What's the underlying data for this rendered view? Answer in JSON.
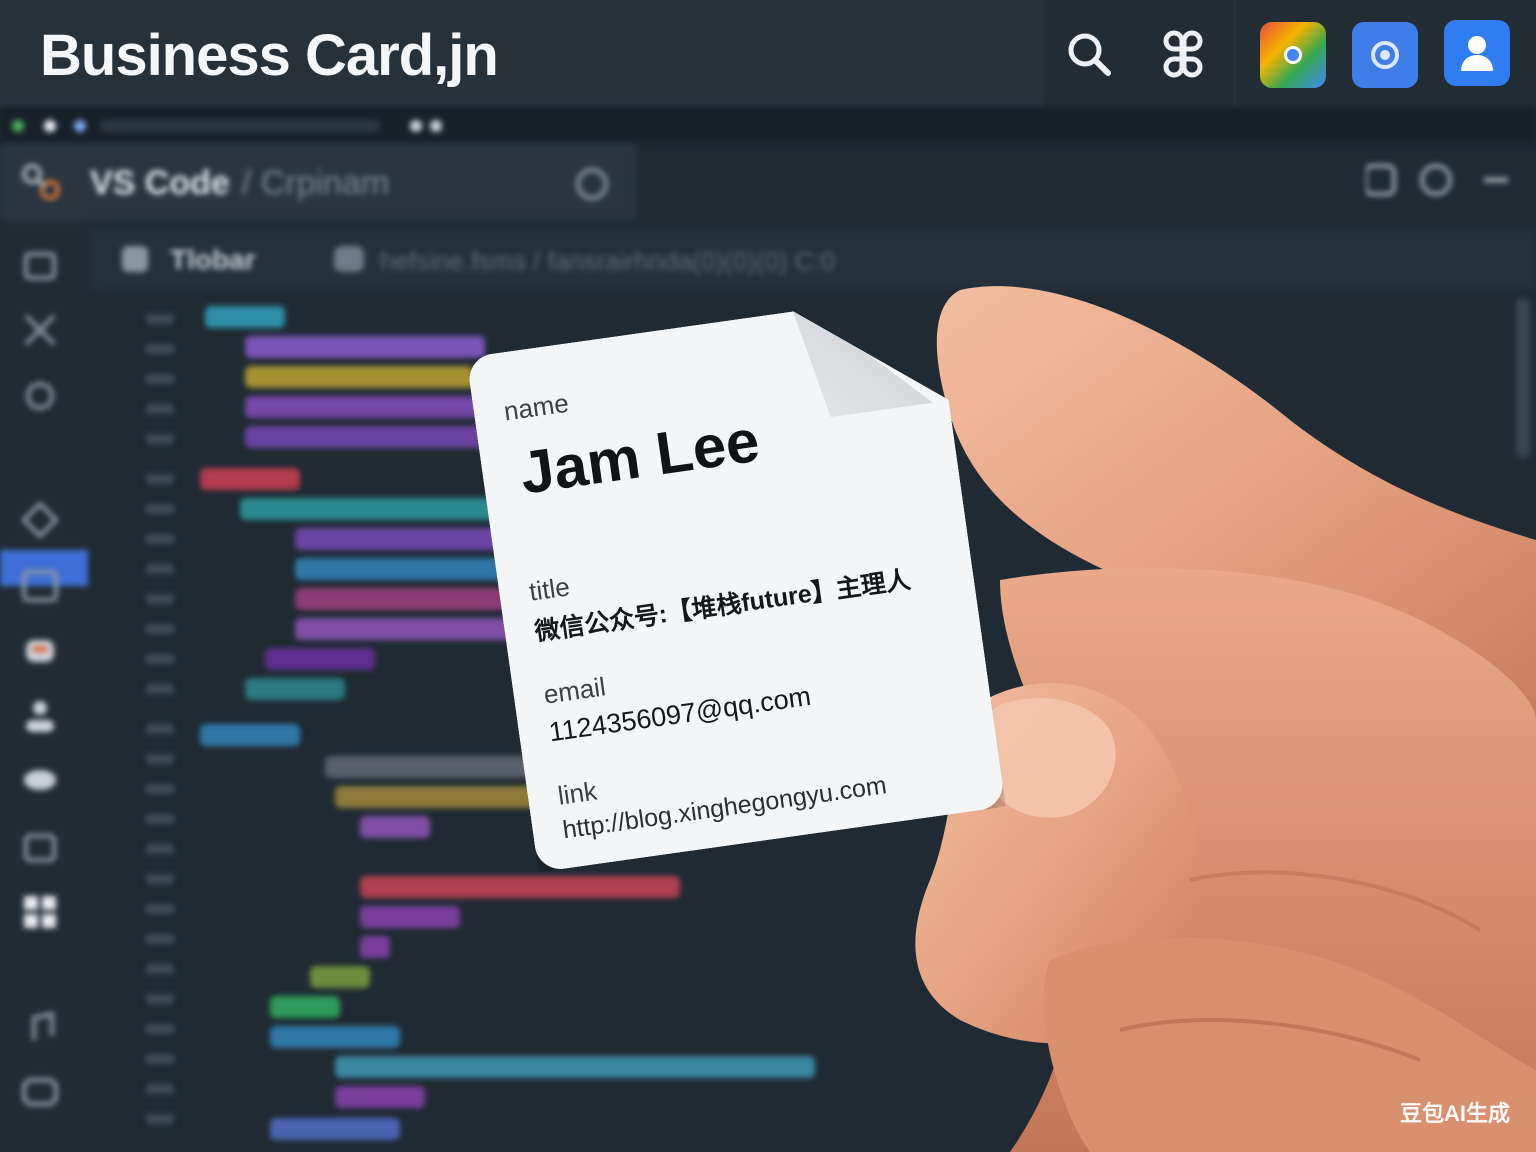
{
  "app": {
    "title": "Business Card,jn"
  },
  "toolbar": {
    "icons": [
      "search-icon",
      "command-icon",
      "chrome-icon",
      "settings-icon",
      "user-icon"
    ]
  },
  "editor": {
    "title": "VS Code",
    "subtitle": "/ Crpinam",
    "crumb": "Tlobar",
    "path": "hefsine.fsms / fansrairhnda(0)(0)(0) C:0"
  },
  "card": {
    "name_label": "name",
    "name": "Jam Lee",
    "title_label": "title",
    "title": "微信公众号:【堆栈future】主理人",
    "email_label": "email",
    "email": "1124356097@qq.com",
    "link_label": "link",
    "link": "http://blog.xinghegongyu.com"
  },
  "watermark": "豆包AI生成",
  "colors": {
    "background": "#1f2a33",
    "topbar": "#26313a",
    "card": "#f4f5f6",
    "skin": "#e8a98a",
    "accent_blue": "#3f7ee8"
  }
}
